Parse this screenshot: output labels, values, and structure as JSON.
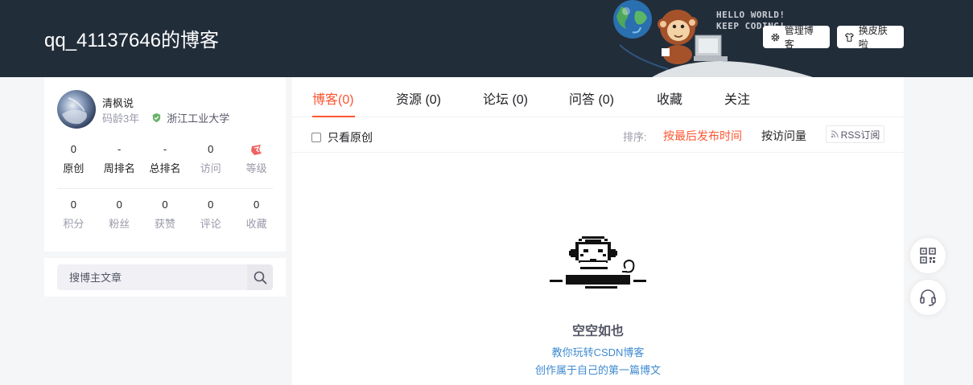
{
  "header": {
    "blog_title": "qq_41137646的博客",
    "banner_line1": "HELLO WORLD!",
    "banner_line2": "KEEP CODING!",
    "manage_label": "管理博客",
    "skin_label": "换皮肤啦",
    "manage_icon": "gear-icon",
    "skin_icon": "shirt-icon",
    "background_color": "#222d3a"
  },
  "profile": {
    "name": "清枫说",
    "code_age": "码龄3年",
    "school": "浙江工业大学",
    "verify_icon": "shield-check-icon",
    "stats_row1": [
      {
        "value": "0",
        "label": "原创"
      },
      {
        "value": "-",
        "label": "周排名"
      },
      {
        "value": "-",
        "label": "总排名"
      },
      {
        "value": "0",
        "label": "访问"
      },
      {
        "value": "",
        "label": "等级"
      }
    ],
    "stats_row2": [
      {
        "value": "0",
        "label": "积分"
      },
      {
        "value": "0",
        "label": "粉丝"
      },
      {
        "value": "0",
        "label": "获赞"
      },
      {
        "value": "0",
        "label": "评论"
      },
      {
        "value": "0",
        "label": "收藏"
      }
    ]
  },
  "search": {
    "placeholder": "搜博主文章",
    "icon": "search-icon"
  },
  "tabs": [
    {
      "label": "博客(0)",
      "active": true
    },
    {
      "label": "资源 (0)",
      "active": false
    },
    {
      "label": "论坛 (0)",
      "active": false
    },
    {
      "label": "问答 (0)",
      "active": false
    },
    {
      "label": "收藏",
      "active": false
    },
    {
      "label": "关注",
      "active": false
    }
  ],
  "filter": {
    "original_only": "只看原创",
    "sort_label": "排序:",
    "sort_latest": "按最后发布时间",
    "sort_visits": "按访问量",
    "rss": "RSS订阅"
  },
  "empty": {
    "title": "空空如也",
    "link1": "教你玩转CSDN博客",
    "link2": "创作属于自己的第一篇博文"
  },
  "float_tools": [
    {
      "icon": "qr-code-icon"
    },
    {
      "icon": "headset-icon"
    }
  ],
  "colors": {
    "accent": "#fc5531",
    "link": "#3f8bd1"
  }
}
